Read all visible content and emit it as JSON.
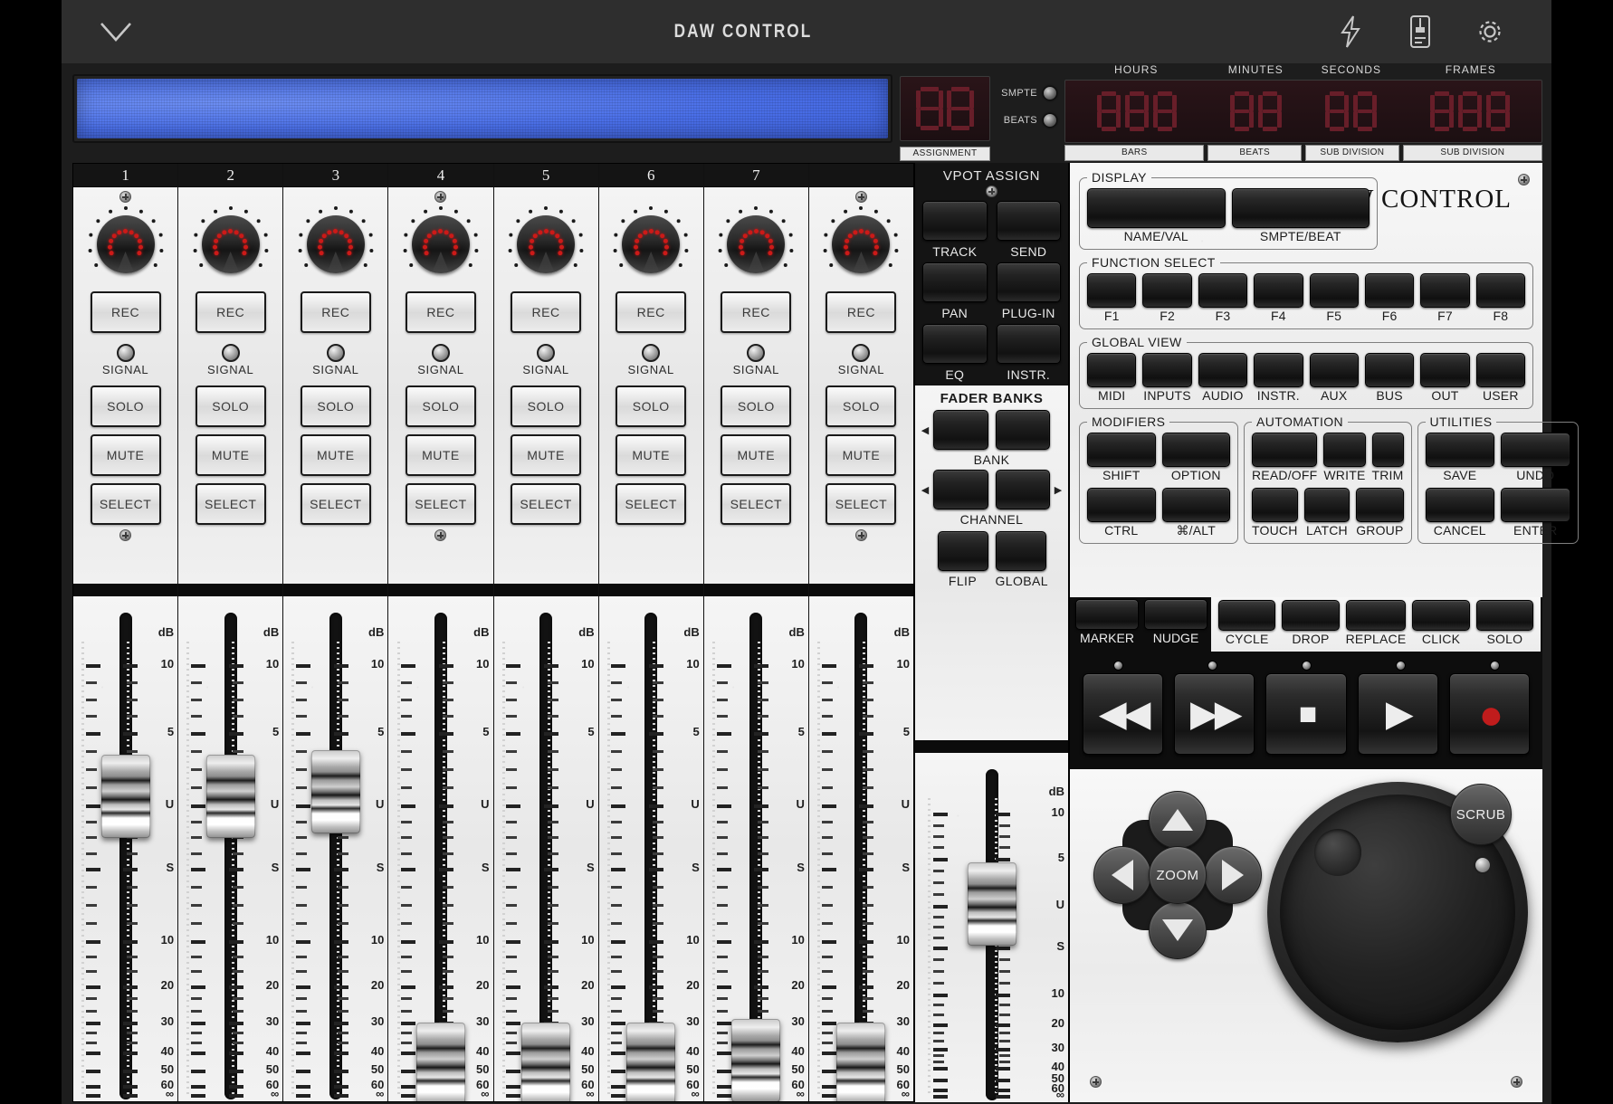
{
  "titlebar": {
    "title": "DAW CONTROL",
    "collapse_icon": "chevron-down-icon",
    "icons": [
      "bolt-icon",
      "device-icon",
      "gear-icon"
    ]
  },
  "display": {
    "lcd_line1": "",
    "lcd_line2": ""
  },
  "timecode": {
    "assignment_label": "ASSIGNMENT",
    "assignment_digits": [
      "8",
      "8"
    ],
    "mode_leds": [
      {
        "label": "SMPTE",
        "on": false
      },
      {
        "label": "BEATS",
        "on": false
      }
    ],
    "headers": [
      "HOURS",
      "MINUTES",
      "SECONDS",
      "FRAMES"
    ],
    "groups": [
      {
        "name": "hours",
        "digits": [
          "8",
          "8",
          "8"
        ]
      },
      {
        "name": "minutes",
        "digits": [
          "8",
          "8"
        ]
      },
      {
        "name": "seconds",
        "digits": [
          "8",
          "8"
        ]
      },
      {
        "name": "frames",
        "digits": [
          "8",
          "8",
          "8"
        ]
      }
    ],
    "footers": [
      "BARS",
      "BEATS",
      "SUB DIVISION",
      "SUB DIVISION"
    ]
  },
  "channels": [
    {
      "number": "1",
      "rec": "REC",
      "signal": "SIGNAL",
      "solo": "SOLO",
      "mute": "MUTE",
      "select": "SELECT",
      "fader_pct": 72
    },
    {
      "number": "2",
      "rec": "REC",
      "signal": "SIGNAL",
      "solo": "SOLO",
      "mute": "MUTE",
      "select": "SELECT",
      "fader_pct": 72
    },
    {
      "number": "3",
      "rec": "REC",
      "signal": "SIGNAL",
      "solo": "SOLO",
      "mute": "MUTE",
      "select": "SELECT",
      "fader_pct": 73
    },
    {
      "number": "4",
      "rec": "REC",
      "signal": "SIGNAL",
      "solo": "SOLO",
      "mute": "MUTE",
      "select": "SELECT",
      "fader_pct": 2
    },
    {
      "number": "5",
      "rec": "REC",
      "signal": "SIGNAL",
      "solo": "SOLO",
      "mute": "MUTE",
      "select": "SELECT",
      "fader_pct": 2
    },
    {
      "number": "6",
      "rec": "REC",
      "signal": "SIGNAL",
      "solo": "SOLO",
      "mute": "MUTE",
      "select": "SELECT",
      "fader_pct": 2
    },
    {
      "number": "7",
      "rec": "REC",
      "signal": "SIGNAL",
      "solo": "SOLO",
      "mute": "MUTE",
      "select": "SELECT",
      "fader_pct": 3
    },
    {
      "number": "",
      "rec": "REC",
      "signal": "SIGNAL",
      "solo": "SOLO",
      "mute": "MUTE",
      "select": "SELECT",
      "fader_pct": 2
    }
  ],
  "fader_scale": {
    "unit": "dB",
    "marks": [
      "10",
      "5",
      "U",
      "S",
      "10",
      "20",
      "30",
      "40",
      "50",
      "60",
      "∞"
    ]
  },
  "master": {
    "fader_pct": 72
  },
  "vpot_assign": {
    "title": "VPOT ASSIGN",
    "buttons": [
      "TRACK",
      "SEND",
      "PAN",
      "PLUG-IN",
      "EQ",
      "INSTR."
    ]
  },
  "fader_banks": {
    "title": "FADER BANKS",
    "bank_label": "BANK",
    "channel_label": "CHANNEL",
    "flip_label": "FLIP",
    "global_label": "GLOBAL",
    "arrow_left": "◀",
    "arrow_right": "▶"
  },
  "right_panel": {
    "brand": "DAW CONTROL",
    "display_group": {
      "legend": "DISPLAY",
      "buttons": [
        "NAME/VAL",
        "SMPTE/BEAT"
      ]
    },
    "function_select": {
      "legend": "FUNCTION SELECT",
      "buttons": [
        "F1",
        "F2",
        "F3",
        "F4",
        "F5",
        "F6",
        "F7",
        "F8"
      ]
    },
    "global_view": {
      "legend": "GLOBAL VIEW",
      "buttons": [
        "MIDI",
        "INPUTS",
        "AUDIO",
        "INSTR.",
        "AUX",
        "BUS",
        "OUT",
        "USER"
      ]
    },
    "modifiers": {
      "legend": "MODIFIERS",
      "buttons": [
        "SHIFT",
        "OPTION",
        "CTRL",
        "⌘/ALT"
      ]
    },
    "automation": {
      "legend": "AUTOMATION",
      "buttons": [
        "READ/OFF",
        "WRITE",
        "TRIM",
        "TOUCH",
        "LATCH",
        "GROUP"
      ]
    },
    "utilities": {
      "legend": "UTILITIES",
      "buttons": [
        "SAVE",
        "UNDO",
        "CANCEL",
        "ENTER"
      ]
    },
    "marker_nudge": [
      "MARKER",
      "NUDGE"
    ],
    "cycle_row": [
      "CYCLE",
      "DROP",
      "REPLACE",
      "CLICK",
      "SOLO"
    ],
    "transport": [
      {
        "name": "rewind",
        "glyph": "◀◀"
      },
      {
        "name": "forward",
        "glyph": "▶▶"
      },
      {
        "name": "stop",
        "glyph": "■"
      },
      {
        "name": "play",
        "glyph": "▶"
      },
      {
        "name": "record",
        "glyph": "●"
      }
    ],
    "navigation": {
      "zoom_label": "ZOOM",
      "scrub_label": "SCRUB"
    }
  },
  "colors": {
    "lcd_blue": "#4a6fe8",
    "led_red": "#cc1a18",
    "record_red": "#c01c1c",
    "panel_white": "#f1f1f1",
    "panel_black": "#0d0d0d"
  }
}
